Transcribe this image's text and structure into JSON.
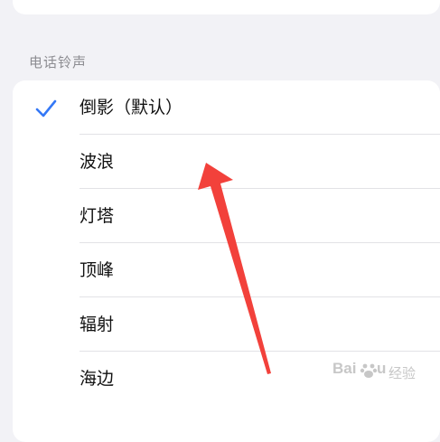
{
  "section": {
    "header": "电话铃声"
  },
  "ringtones": [
    {
      "label": "倒影（默认）",
      "selected": true
    },
    {
      "label": "波浪",
      "selected": false
    },
    {
      "label": "灯塔",
      "selected": false
    },
    {
      "label": "顶峰",
      "selected": false
    },
    {
      "label": "辐射",
      "selected": false
    },
    {
      "label": "海边",
      "selected": false
    }
  ],
  "colors": {
    "accent": "#3478f6",
    "annotation_arrow": "#f2413b"
  },
  "icons": {
    "selected": "checkmark-icon"
  },
  "watermark": {
    "brand_a": "Bai",
    "brand_b": "u",
    "sub": "经验"
  }
}
